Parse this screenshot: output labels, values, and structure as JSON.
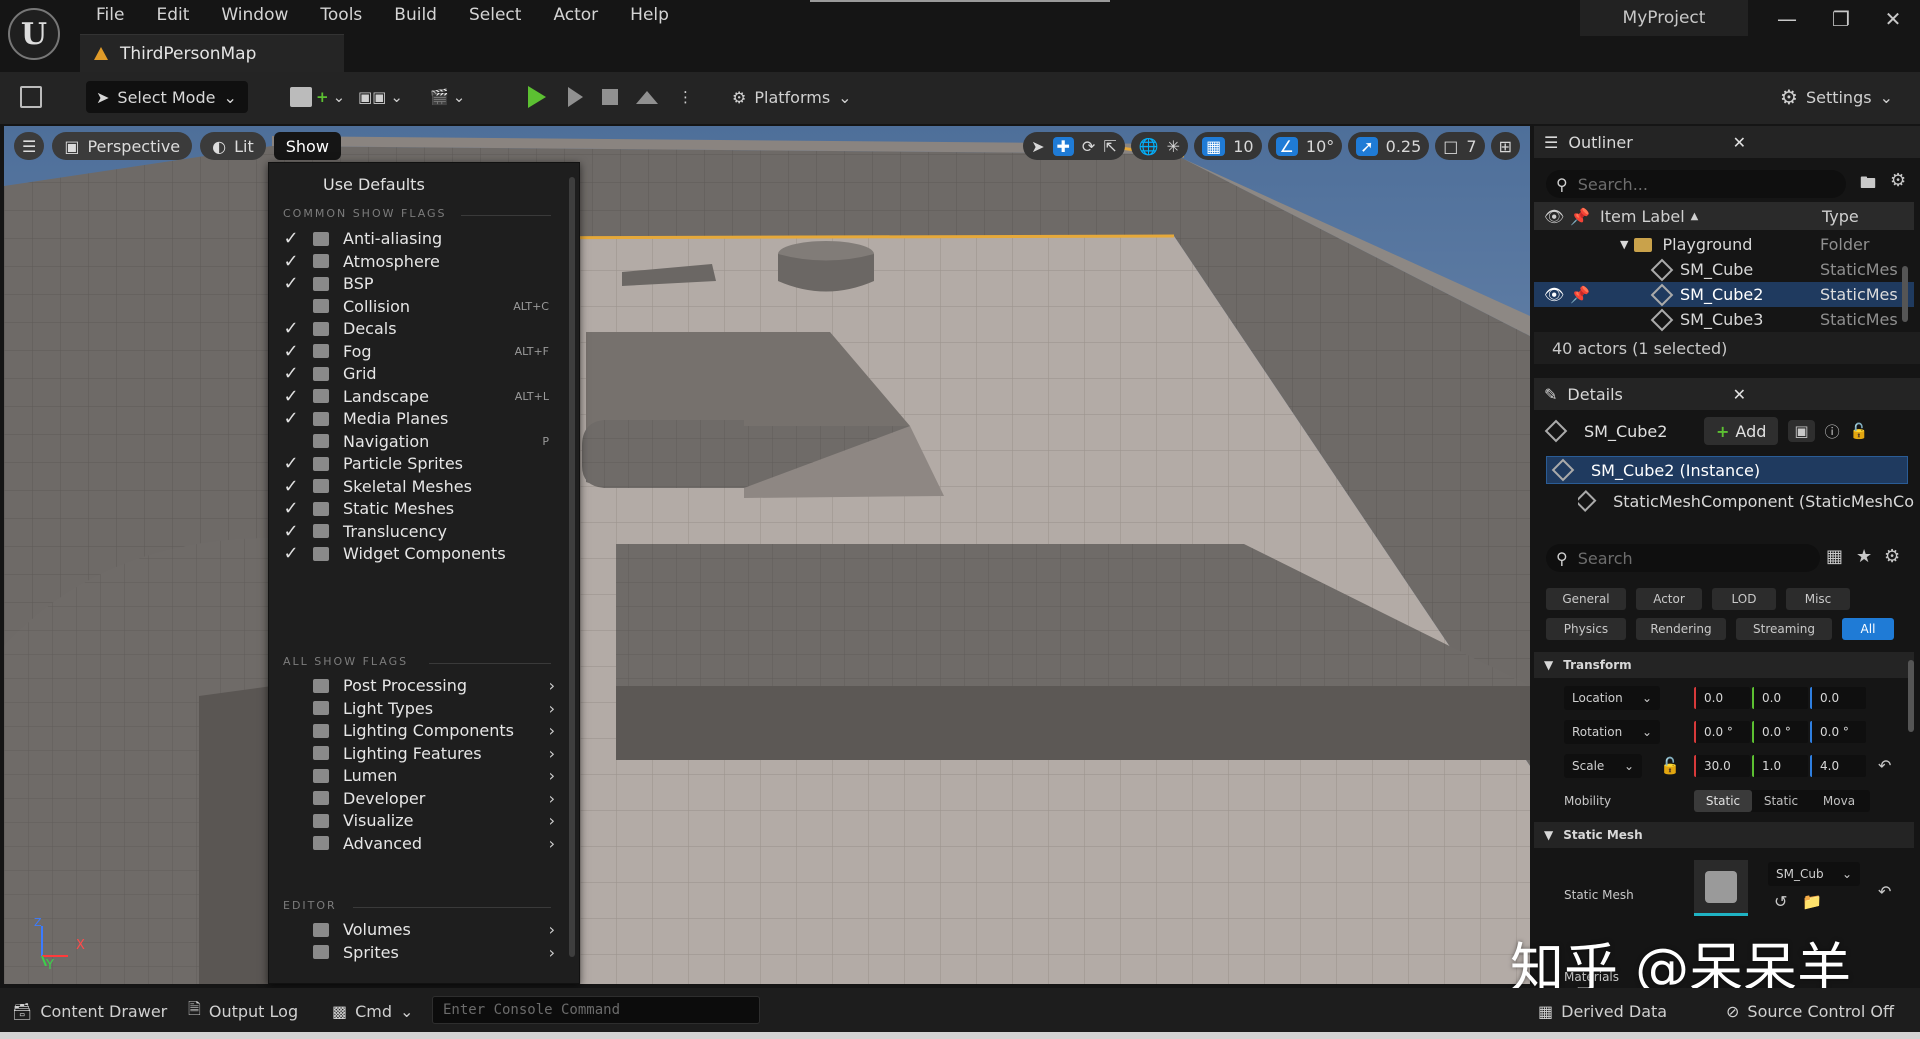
{
  "title_bar": {
    "menus": [
      "File",
      "Edit",
      "Window",
      "Tools",
      "Build",
      "Select",
      "Actor",
      "Help"
    ],
    "tab_label": "ThirdPersonMap",
    "project_name": "MyProject",
    "window_controls": [
      "minimize-icon",
      "restore-icon",
      "close-icon"
    ]
  },
  "toolbar": {
    "select_mode": "Select Mode",
    "platforms": "Platforms",
    "settings": "Settings"
  },
  "viewport": {
    "perspective": "Perspective",
    "lit": "Lit",
    "show": "Show",
    "grid_size": "10",
    "rotation_snap": "10°",
    "scale_snap": "0.25",
    "camera_speed": "7",
    "axis": {
      "x": "X",
      "y": "Y",
      "z": "Z"
    }
  },
  "show_menu": {
    "use_defaults": "Use Defaults",
    "common_header": "COMMON SHOW FLAGS",
    "all_header": "ALL SHOW FLAGS",
    "editor_header": "EDITOR",
    "common_flags": [
      {
        "label": "Anti-aliasing",
        "checked": true,
        "key": ""
      },
      {
        "label": "Atmosphere",
        "checked": true,
        "key": ""
      },
      {
        "label": "BSP",
        "checked": true,
        "key": ""
      },
      {
        "label": "Collision",
        "checked": false,
        "key": "ALT+C"
      },
      {
        "label": "Decals",
        "checked": true,
        "key": ""
      },
      {
        "label": "Fog",
        "checked": true,
        "key": "ALT+F"
      },
      {
        "label": "Grid",
        "checked": true,
        "key": ""
      },
      {
        "label": "Landscape",
        "checked": true,
        "key": "ALT+L"
      },
      {
        "label": "Media Planes",
        "checked": true,
        "key": ""
      },
      {
        "label": "Navigation",
        "checked": false,
        "key": "P"
      },
      {
        "label": "Particle Sprites",
        "checked": true,
        "key": ""
      },
      {
        "label": "Skeletal Meshes",
        "checked": true,
        "key": ""
      },
      {
        "label": "Static Meshes",
        "checked": true,
        "key": ""
      },
      {
        "label": "Translucency",
        "checked": true,
        "key": ""
      },
      {
        "label": "Widget Components",
        "checked": true,
        "key": ""
      }
    ],
    "all_flags": [
      "Post Processing",
      "Light Types",
      "Lighting Components",
      "Lighting Features",
      "Lumen",
      "Developer",
      "Visualize",
      "Advanced"
    ],
    "editor_flags": [
      "Volumes",
      "Sprites"
    ]
  },
  "outliner": {
    "title": "Outliner",
    "search_placeholder": "Search...",
    "col_label": "Item Label",
    "col_type": "Type",
    "rows": [
      {
        "label": "Playground",
        "type": "Folder"
      },
      {
        "label": "SM_Cube",
        "type": "StaticMes"
      },
      {
        "label": "SM_Cube2",
        "type": "StaticMes"
      },
      {
        "label": "SM_Cube3",
        "type": "StaticMes"
      }
    ],
    "actor_count": "40 actors (1 selected)"
  },
  "details": {
    "title": "Details",
    "object_name": "SM_Cube2",
    "add_label": "Add",
    "instance": "SM_Cube2 (Instance)",
    "component": "StaticMeshComponent (StaticMeshCo",
    "search_placeholder": "Search",
    "filters_row1": [
      "General",
      "Actor",
      "LOD",
      "Misc"
    ],
    "filters_row2": [
      "Physics",
      "Rendering",
      "Streaming",
      "All"
    ],
    "transform_header": "Transform",
    "location": {
      "label": "Location",
      "values": [
        "0.0",
        "0.0",
        "0.0"
      ]
    },
    "rotation": {
      "label": "Rotation",
      "values": [
        "0.0 °",
        "0.0 °",
        "0.0 °"
      ]
    },
    "scale": {
      "label": "Scale",
      "values": [
        "30.0",
        "1.0",
        "4.0"
      ]
    },
    "mobility_label": "Mobility",
    "mobility_options": [
      "Static",
      "Static",
      "Mova"
    ],
    "static_mesh_header": "Static Mesh",
    "static_mesh_label": "Static Mesh",
    "static_mesh_value": "SM_Cub",
    "materials_label": "Materials"
  },
  "status_bar": {
    "content_drawer": "Content Drawer",
    "output_log": "Output Log",
    "cmd": "Cmd",
    "console_placeholder": "Enter Console Command",
    "derived_data": "Derived Data",
    "source_control": "Source Control Off"
  },
  "watermark": "知乎 @呆呆羊",
  "colors": {
    "accent": "#1f7bd6",
    "play": "#5cc032",
    "warning": "#e09b29",
    "selection_outline": "#e6a93a",
    "cube_blue": "#1e88e5"
  }
}
